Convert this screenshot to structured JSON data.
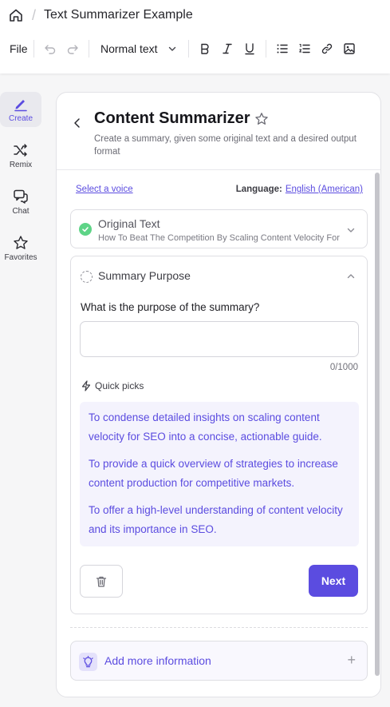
{
  "breadcrumb": {
    "separator": "/",
    "document_title": "Text Summarizer Example"
  },
  "toolbar": {
    "file_label": "File",
    "text_style": "Normal text"
  },
  "nav": [
    {
      "label": "Create",
      "icon": "pen-icon",
      "active": true
    },
    {
      "label": "Remix",
      "icon": "shuffle-icon",
      "active": false
    },
    {
      "label": "Chat",
      "icon": "chat-icon",
      "active": false
    },
    {
      "label": "Favorites",
      "icon": "star-icon",
      "active": false
    }
  ],
  "panel": {
    "title": "Content Summarizer",
    "description": "Create a summary, given some original text and a desired output format",
    "voice_link": "Select a voice",
    "language_label": "Language:",
    "language_value": "English (American)",
    "original_text": {
      "title": "Original Text",
      "subtitle": "How To Beat The Competition By Scaling Content Velocity For SEO"
    },
    "summary_purpose": {
      "title": "Summary Purpose",
      "question": "What is the purpose of the summary?",
      "input_value": "",
      "counter": "0/1000",
      "quick_picks_label": "Quick picks",
      "picks": [
        "To condense detailed insights on scaling content velocity for SEO into a concise, actionable guide.",
        "To provide a quick overview of strategies to increase content production for competitive markets.",
        "To offer a high-level understanding of content velocity and its importance in SEO."
      ],
      "next_label": "Next"
    },
    "add_more_label": "Add more information",
    "add_more_symbol": "+"
  },
  "colors": {
    "accent": "#5b4ce0",
    "success": "#5ed487",
    "picks_bg": "#f4f3fd"
  }
}
